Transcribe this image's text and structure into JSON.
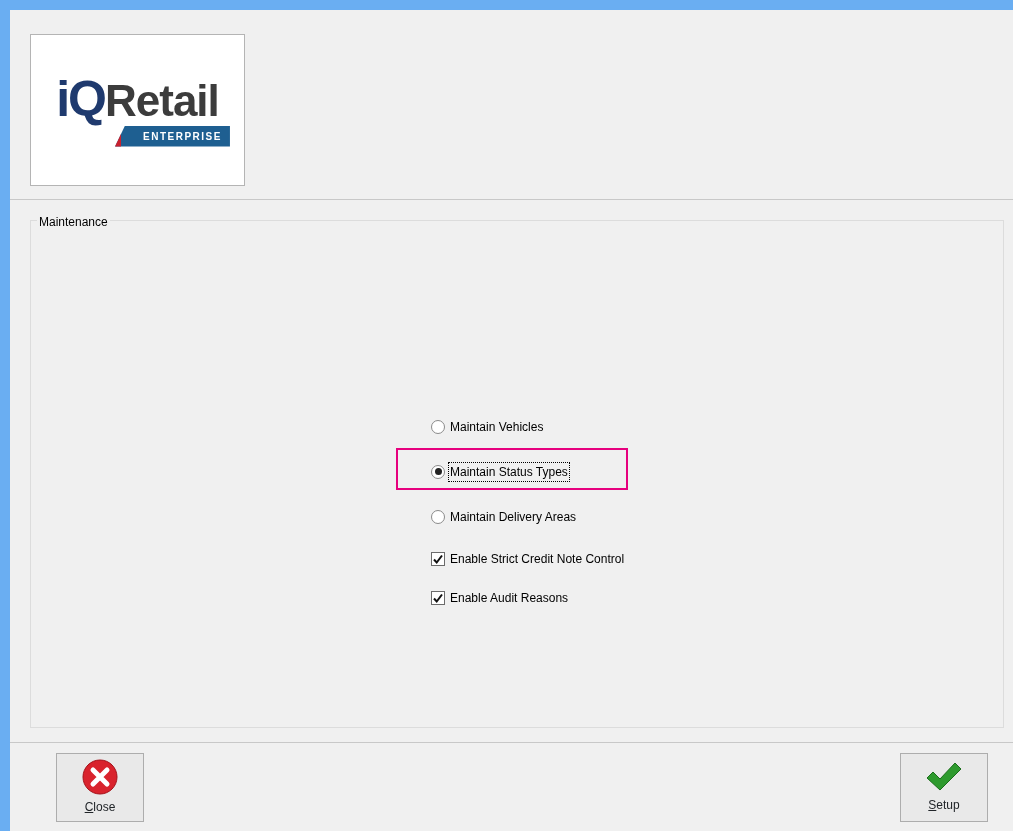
{
  "logo": {
    "prefix": "iQ",
    "name": "Retail",
    "edition": "ENTERPRISE"
  },
  "group": {
    "title": "Maintenance"
  },
  "options": [
    {
      "kind": "radio",
      "label": "Maintain Vehicles",
      "selected": false,
      "focused": false,
      "highlighted": false
    },
    {
      "kind": "radio",
      "label": "Maintain Status Types",
      "selected": true,
      "focused": true,
      "highlighted": true
    },
    {
      "kind": "radio",
      "label": "Maintain Delivery Areas",
      "selected": false,
      "focused": false,
      "highlighted": false
    },
    {
      "kind": "checkbox",
      "label": "Enable Strict Credit Note Control",
      "checked": true
    },
    {
      "kind": "checkbox",
      "label": "Enable Audit Reasons",
      "checked": true
    }
  ],
  "buttons": [
    {
      "kind": "close",
      "label": "Close",
      "underline_first": true
    },
    {
      "kind": "setup",
      "label": "Setup",
      "underline_first": true
    }
  ]
}
